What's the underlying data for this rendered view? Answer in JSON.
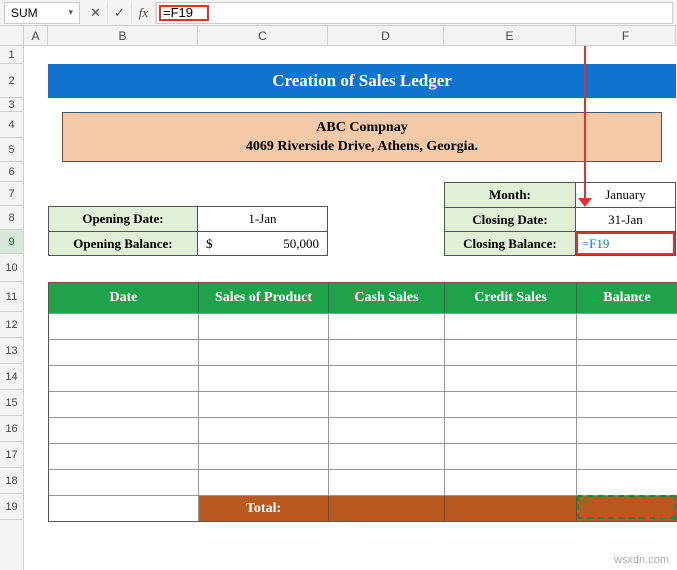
{
  "formula_bar": {
    "namebox": "SUM",
    "cancel_icon": "✕",
    "enter_icon": "✓",
    "fx_label": "fx",
    "formula": "=F19"
  },
  "columns": [
    "A",
    "B",
    "C",
    "D",
    "E",
    "F"
  ],
  "rows": [
    "1",
    "2",
    "3",
    "4",
    "5",
    "6",
    "7",
    "8",
    "9",
    "10",
    "11",
    "12",
    "13",
    "14",
    "15",
    "16",
    "17",
    "18",
    "19"
  ],
  "active_row": "9",
  "title": "Creation of Sales Ledger",
  "company": {
    "name": "ABC Compnay",
    "address": "4069 Riverside Drive, Athens, Georgia."
  },
  "opening": {
    "date_label": "Opening Date:",
    "date_value": "1-Jan",
    "balance_label": "Opening Balance:",
    "balance_currency": "$",
    "balance_value": "50,000"
  },
  "closing": {
    "month_label": "Month:",
    "month_value": "January",
    "date_label": "Closing Date:",
    "date_value": "31-Jan",
    "balance_label": "Closing Balance:",
    "balance_value": "=F19"
  },
  "table": {
    "headers": [
      "Date",
      "Sales of Product",
      "Cash Sales",
      "Credit Sales",
      "Balance"
    ],
    "total_label": "Total:"
  },
  "watermark": "wsxdn.com"
}
